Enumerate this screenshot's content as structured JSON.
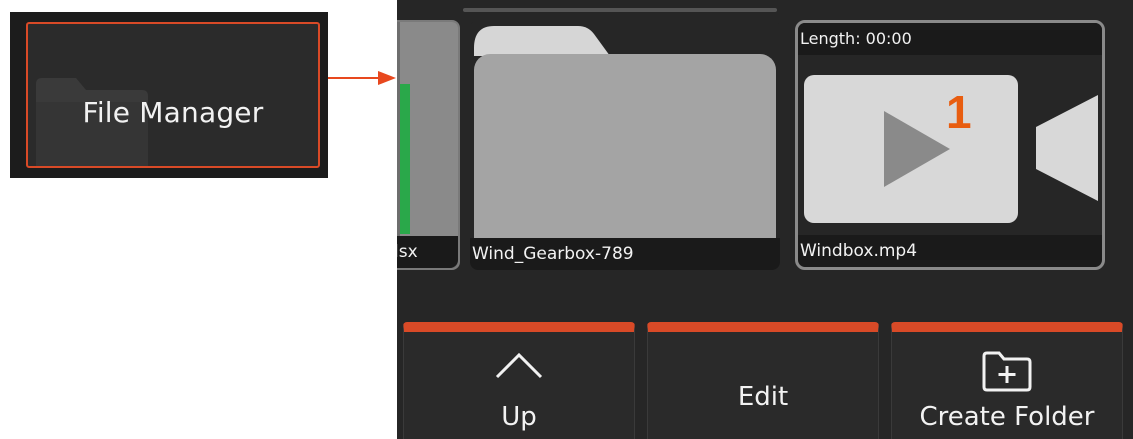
{
  "callout": {
    "label": "File Manager",
    "icon": "folder-icon",
    "border_color": "#d94a27",
    "arrow_color": "#e8481e"
  },
  "files": [
    {
      "name": "lsx",
      "type": "spreadsheet"
    },
    {
      "name": "Wind_Gearbox-789",
      "type": "folder"
    },
    {
      "name": "Windbox.mp4",
      "type": "video",
      "length": "Length: 00:00",
      "badge": "1"
    }
  ],
  "actions": {
    "up": {
      "label": "Up",
      "icon": "chevron-up-icon"
    },
    "edit": {
      "label": "Edit"
    },
    "create_folder": {
      "label": "Create Folder",
      "icon": "folder-plus-icon"
    }
  },
  "colors": {
    "accent": "#d94a27",
    "badge": "#e85d10",
    "spreadsheet": "#2aa84a"
  }
}
